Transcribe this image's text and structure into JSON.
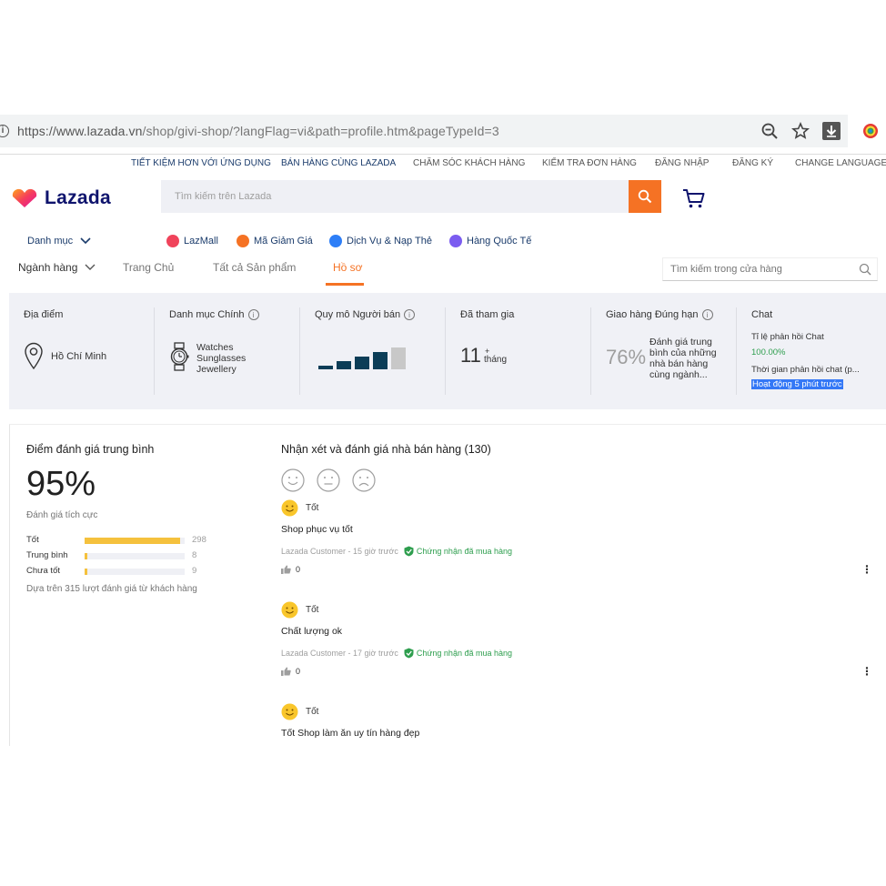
{
  "browser": {
    "url_main": "https://www.lazada.vn",
    "url_path": "/shop/givi-shop/?langFlag=vi&path=profile.htm&pageTypeId=3",
    "icons": [
      "info-icon",
      "zoom-out-icon",
      "bookmark-star-icon",
      "download-icon",
      "extension-icon"
    ]
  },
  "toplinks": [
    "TIẾT KIỆM HƠN VỚI ỨNG DỤNG",
    "BÁN HÀNG CÙNG LAZADA",
    "CHĂM SÓC KHÁCH HÀNG",
    "KIỂM TRA ĐƠN HÀNG",
    "ĐĂNG NHẬP",
    "ĐĂNG KÝ",
    "CHANGE LANGUAGE"
  ],
  "header": {
    "logo": "Lazada",
    "search_placeholder": "Tìm kiếm trên Lazada"
  },
  "catrow": {
    "menu": "Danh mục",
    "links": [
      {
        "label": "LazMall",
        "color": "#f0435b"
      },
      {
        "label": "Mã Giảm Giá",
        "color": "#f57224"
      },
      {
        "label": "Dịch Vụ & Nạp Thẻ",
        "color": "#2d7ef7"
      },
      {
        "label": "Hàng Quốc Tế",
        "color": "#7b5cf0"
      }
    ]
  },
  "tabs": {
    "industry": "Ngành hàng",
    "items": [
      "Trang Chủ",
      "Tất cả Sản phẩm",
      "Hồ sơ"
    ],
    "active": "Hồ sơ",
    "search_placeholder": "Tìm kiếm trong cửa hàng"
  },
  "info": {
    "location_label": "Địa điểm",
    "location_value": "Hồ Chí Minh",
    "category_label": "Danh mục Chính",
    "categories": [
      "Watches",
      "Sunglasses",
      "Jewellery"
    ],
    "seller_size_label": "Quy mô Người bán",
    "seller_size_level": 4,
    "seller_size_max": 5,
    "joined_label": "Đã tham gia",
    "joined_value": "11",
    "joined_plus": "+",
    "joined_unit": "tháng",
    "ontime_label": "Giao hàng Đúng hạn",
    "ontime_value": "76%",
    "ontime_desc": "Đánh giá trung bình của những nhà bán hàng cùng ngành...",
    "chat_label": "Chat",
    "chat_rate_label": "Tỉ lệ phản hồi Chat",
    "chat_rate_value": "100.00%",
    "chat_time_label": "Thời gian phản hồi chat (p...",
    "chat_time_value": "Hoạt động 5 phút trước"
  },
  "rating": {
    "title": "Điểm đánh giá trung bình",
    "score": "95%",
    "positive_label": "Đánh giá tích cực",
    "rows": [
      {
        "label": "Tốt",
        "count": "298",
        "value": 298
      },
      {
        "label": "Trung bình",
        "count": "8",
        "value": 8
      },
      {
        "label": "Chưa tốt",
        "count": "9",
        "value": 9
      }
    ],
    "total": 315,
    "based_on": "Dựa trên 315 lượt đánh giá từ khách hàng"
  },
  "reviews": {
    "title": "Nhận xét và đánh giá nhà bán hàng (130)",
    "items": [
      {
        "sentiment": "Tốt",
        "text": "Shop phục vụ tốt",
        "author": "Lazada Customer - 15 giờ trước",
        "verified": "Chứng nhận đã mua hàng",
        "likes": "0",
        "more": "⋮"
      },
      {
        "sentiment": "Tốt",
        "text": "Chất lượng ok",
        "author": "Lazada Customer - 17 giờ trước",
        "verified": "Chứng nhận đã mua hàng",
        "likes": "0",
        "more": "⋮"
      },
      {
        "sentiment": "Tốt",
        "text": "Tốt Shop làm ăn uy tín hàng đẹp"
      }
    ]
  },
  "colors": {
    "accent": "#f57224",
    "navy": "#0f146d",
    "bar_dark": "#0b3d57",
    "bar_light": "#c8c8c8",
    "rating_fill": "#f5c13d",
    "green": "#2e9e4e"
  }
}
